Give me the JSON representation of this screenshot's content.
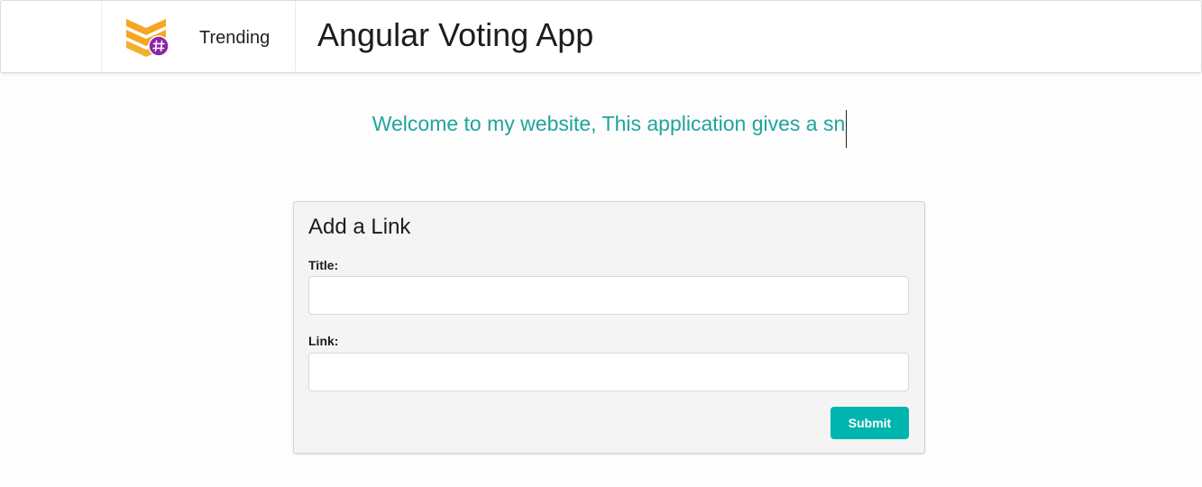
{
  "header": {
    "nav_item_label": "Trending",
    "app_title": "Angular Voting App"
  },
  "welcome": {
    "text": "Welcome to my website, This application gives a sn"
  },
  "form": {
    "title": "Add a Link",
    "title_label": "Title:",
    "title_value": "",
    "link_label": "Link:",
    "link_value": "",
    "submit_label": "Submit"
  },
  "icons": {
    "logo": "chevron-hash-logo-icon"
  },
  "colors": {
    "accent": "#00b5ad",
    "welcome_text": "#20a49c",
    "logo_orange": "#f5a623",
    "logo_purple": "#8e24aa"
  }
}
